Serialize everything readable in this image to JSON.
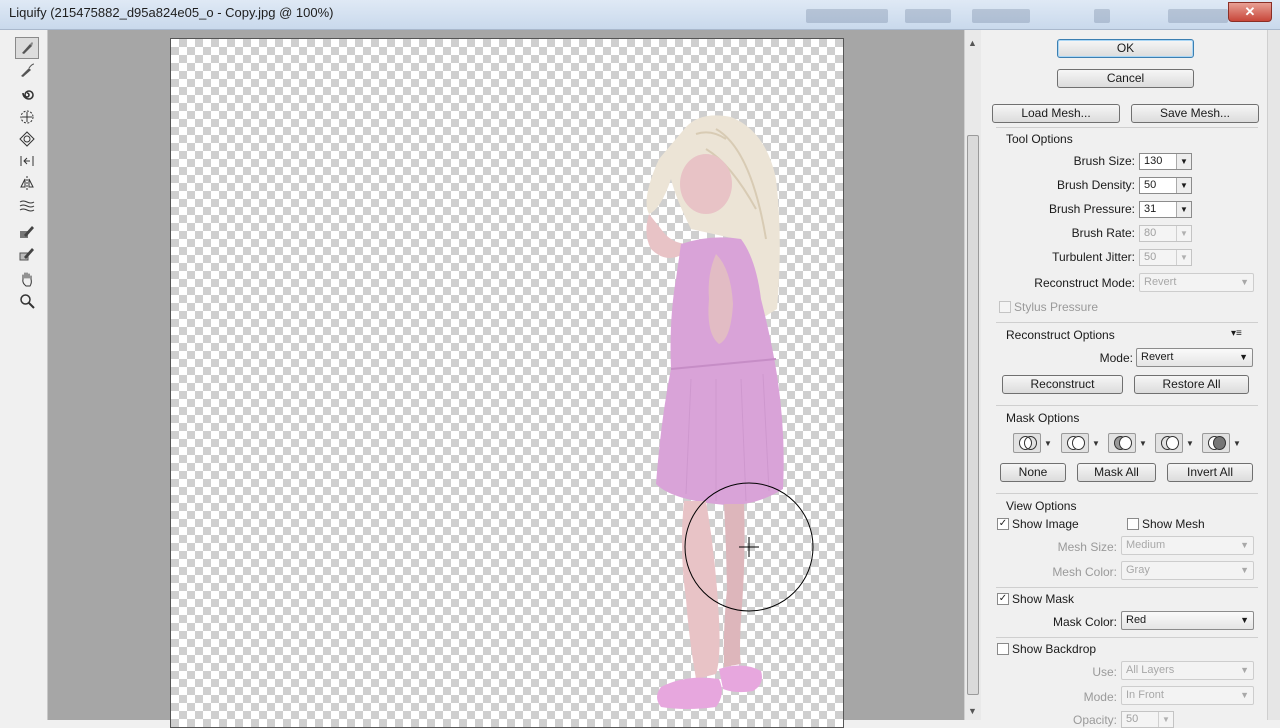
{
  "window": {
    "title": "Liquify (215475882_d95a824e05_o - Copy.jpg @ 100%)",
    "close_glyph": "✕"
  },
  "tools": [
    "forward-warp-icon",
    "reconstruct-icon",
    "twirl-icon",
    "pucker-icon",
    "bloat-icon",
    "push-left-icon",
    "mirror-icon",
    "turbulence-icon",
    "freeze-mask-icon",
    "thaw-mask-icon",
    "hand-icon",
    "zoom-icon"
  ],
  "buttons": {
    "ok": "OK",
    "cancel": "Cancel",
    "load_mesh": "Load Mesh...",
    "save_mesh": "Save Mesh...",
    "reconstruct": "Reconstruct",
    "restore_all": "Restore All",
    "none": "None",
    "mask_all": "Mask All",
    "invert_all": "Invert All"
  },
  "tool_options": {
    "heading": "Tool Options",
    "brush_size_label": "Brush Size:",
    "brush_size": "130",
    "brush_density_label": "Brush Density:",
    "brush_density": "50",
    "brush_pressure_label": "Brush Pressure:",
    "brush_pressure": "31",
    "brush_rate_label": "Brush Rate:",
    "brush_rate": "80",
    "turbulent_jitter_label": "Turbulent Jitter:",
    "turbulent_jitter": "50",
    "reconstruct_mode_label": "Reconstruct Mode:",
    "reconstruct_mode": "Revert",
    "stylus_pressure": "Stylus Pressure"
  },
  "reconstruct_options": {
    "heading": "Reconstruct Options",
    "mode_label": "Mode:",
    "mode": "Revert"
  },
  "mask_options": {
    "heading": "Mask Options"
  },
  "view_options": {
    "heading": "View Options",
    "show_image": "Show Image",
    "show_image_checked": true,
    "show_mesh": "Show Mesh",
    "show_mesh_checked": false,
    "mesh_size_label": "Mesh Size:",
    "mesh_size": "Medium",
    "mesh_color_label": "Mesh Color:",
    "mesh_color": "Gray",
    "show_mask": "Show Mask",
    "show_mask_checked": true,
    "mask_color_label": "Mask Color:",
    "mask_color": "Red",
    "show_backdrop": "Show Backdrop",
    "show_backdrop_checked": false,
    "use_label": "Use:",
    "use": "All Layers",
    "mode_label": "Mode:",
    "mode": "In Front",
    "opacity_label": "Opacity:",
    "opacity": "50"
  },
  "colors": {
    "dress": "#d9a3d8",
    "hair": "#ece4d6",
    "skin": "#e8c3c6",
    "canvas_bg": "#a6a6a6"
  }
}
